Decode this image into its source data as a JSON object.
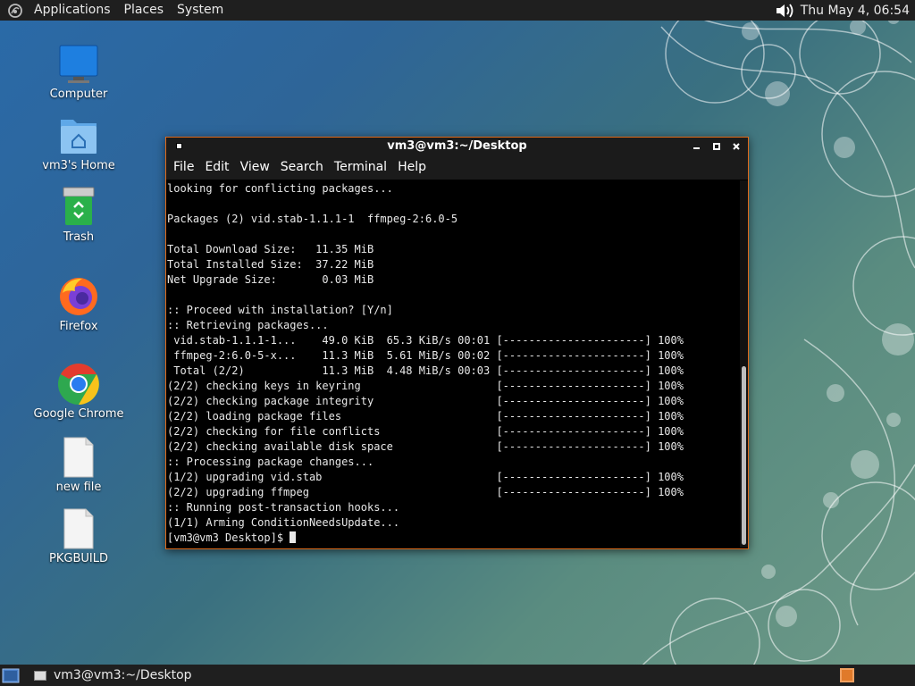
{
  "top_panel": {
    "menus": [
      "Applications",
      "Places",
      "System"
    ],
    "clock": "Thu May  4, 06:54"
  },
  "desktop_icons": [
    {
      "label": "Computer",
      "icon": "computer-icon"
    },
    {
      "label": "vm3's Home",
      "icon": "home-folder-icon"
    },
    {
      "label": "Trash",
      "icon": "trash-icon"
    },
    {
      "label": "Firefox",
      "icon": "firefox-icon"
    },
    {
      "label": "Google Chrome",
      "icon": "chrome-icon"
    },
    {
      "label": "new file",
      "icon": "file-icon"
    },
    {
      "label": "PKGBUILD",
      "icon": "file-icon"
    }
  ],
  "terminal": {
    "title": "vm3@vm3:~/Desktop",
    "menus": [
      "File",
      "Edit",
      "View",
      "Search",
      "Terminal",
      "Help"
    ],
    "lines": [
      "looking for conflicting packages...",
      "",
      "Packages (2) vid.stab-1.1.1-1  ffmpeg-2:6.0-5",
      "",
      "Total Download Size:   11.35 MiB",
      "Total Installed Size:  37.22 MiB",
      "Net Upgrade Size:       0.03 MiB",
      "",
      ":: Proceed with installation? [Y/n]",
      ":: Retrieving packages...",
      " vid.stab-1.1.1-1...    49.0 KiB  65.3 KiB/s 00:01 [----------------------] 100%",
      " ffmpeg-2:6.0-5-x...    11.3 MiB  5.61 MiB/s 00:02 [----------------------] 100%",
      " Total (2/2)            11.3 MiB  4.48 MiB/s 00:03 [----------------------] 100%",
      "(2/2) checking keys in keyring                     [----------------------] 100%",
      "(2/2) checking package integrity                   [----------------------] 100%",
      "(2/2) loading package files                        [----------------------] 100%",
      "(2/2) checking for file conflicts                  [----------------------] 100%",
      "(2/2) checking available disk space                [----------------------] 100%",
      ":: Processing package changes...",
      "(1/2) upgrading vid.stab                           [----------------------] 100%",
      "(2/2) upgrading ffmpeg                             [----------------------] 100%",
      ":: Running post-transaction hooks...",
      "(1/1) Arming ConditionNeedsUpdate...",
      "[vm3@vm3 Desktop]$ "
    ]
  },
  "taskbar": {
    "tasks": [
      {
        "label": "vm3@vm3:~/Desktop"
      }
    ]
  },
  "colors": {
    "panel_bg": "#1f1f1f",
    "window_border": "#e06a1a",
    "terminal_bg": "#000000",
    "terminal_fg": "#e8e8e8",
    "workspace_accent": "#e07a2a"
  }
}
